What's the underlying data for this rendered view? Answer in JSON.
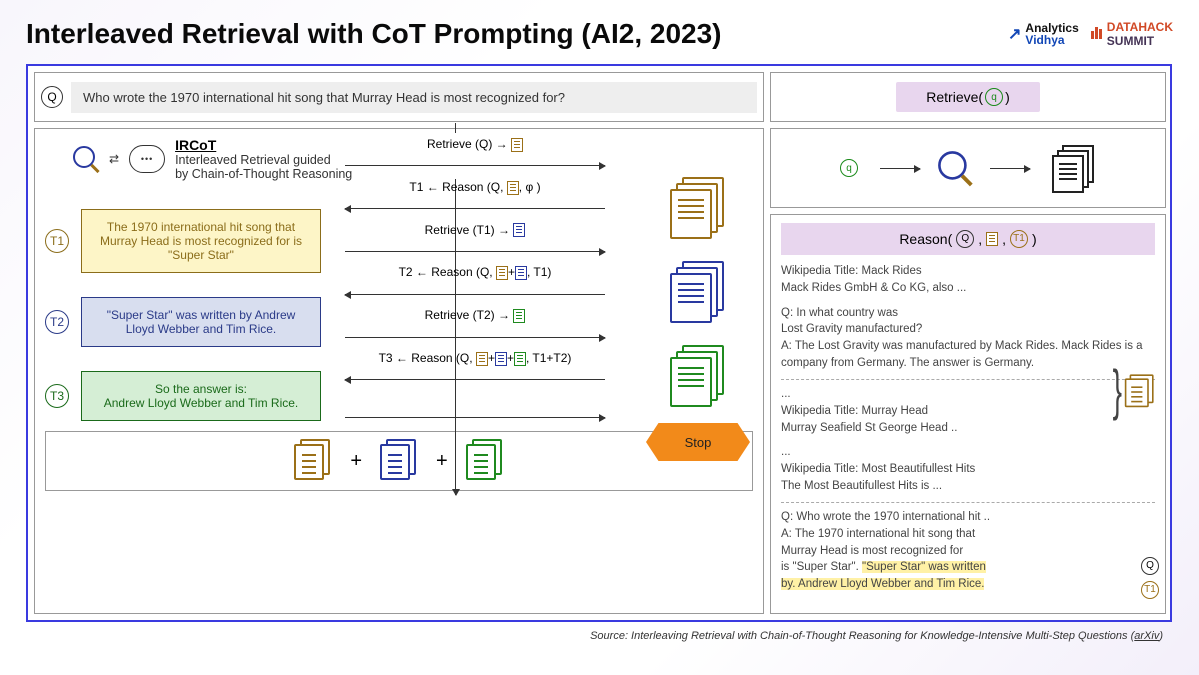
{
  "header": {
    "title": "Interleaved Retrieval with CoT Prompting (AI2, 2023)",
    "logo1_line1": "Analytics",
    "logo1_line2": "Vidhya",
    "logo2_line1": "DATAHACK",
    "logo2_line2": "SUMMIT"
  },
  "question": {
    "q_symbol": "Q",
    "text": "Who wrote the 1970 international hit song that Murray Head is most recognized for?"
  },
  "retrieve_header": {
    "prefix": "Retrieve(",
    "q": "q",
    "suffix": ")"
  },
  "right_top": {
    "q": "q"
  },
  "ircot": {
    "title": "IRCoT",
    "subtitle1": "Interleaved Retrieval guided",
    "subtitle2": "by Chain-of-Thought Reasoning"
  },
  "steps": {
    "t1_label": "T1",
    "t1_text": "The 1970 international hit song that Murray Head is most recognized for is \"Super Star\"",
    "t2_label": "T2",
    "t2_text": "\"Super Star\" was written by Andrew Lloyd Webber and Tim Rice.",
    "t3_label": "T3",
    "t3_text_line1": "So the answer is:",
    "t3_text_line2": "Andrew Lloyd Webber and Tim Rice."
  },
  "arrows": {
    "a1": "Retrieve (Q) →",
    "a2": "T1 ← Reason (Q,",
    "a2_phi": ", φ )",
    "a3": "Retrieve (T1) →",
    "a4_pre": "T2 ← Reason (Q,",
    "a4_mid": "+",
    "a4_post": ", T1)",
    "a5": "Retrieve (T2) →",
    "a6_pre": "T3 ← Reason (Q,",
    "a6_post": ", T1+T2)",
    "stop": "Stop"
  },
  "combine": {
    "plus": "+"
  },
  "reason_header": {
    "prefix": "Reason(",
    "q": "Q",
    "t": "T1",
    "suffix": ")"
  },
  "right_text": {
    "p1_title": "Wikipedia Title: Mack Rides",
    "p1_body": "Mack Rides GmbH & Co KG, also ...",
    "p2_q": "Q: In what country was",
    "p2_q2": "Lost Gravity manufactured?",
    "p2_a": "A: The Lost Gravity was manufactured by Mack Rides. Mack Rides is a company from Germany. The answer is Germany.",
    "dots": "...",
    "p3_title": "Wikipedia Title: Murray Head",
    "p3_body": "Murray Seafield St George Head ..",
    "p4_title": "Wikipedia Title: Most Beautifullest Hits",
    "p4_body": "The Most Beautifullest Hits is ...",
    "p5_q": "Q: Who wrote the 1970 international hit ..",
    "p5_a1": "A: The 1970 international hit song that",
    "p5_a2": "Murray Head is most recognized for",
    "p5_a3_pre": "is \"Super Star\". ",
    "p5_a3_hl": "\"Super Star\" was written",
    "p5_a4_hl": "by. Andrew Lloyd Webber and Tim Rice.",
    "side_q": "Q",
    "side_t1": "T1"
  },
  "source": {
    "text": "Source: Interleaving Retrieval with Chain-of-Thought Reasoning for Knowledge-Intensive Multi-Step Questions (",
    "link": "arXiv",
    "close": ")"
  }
}
